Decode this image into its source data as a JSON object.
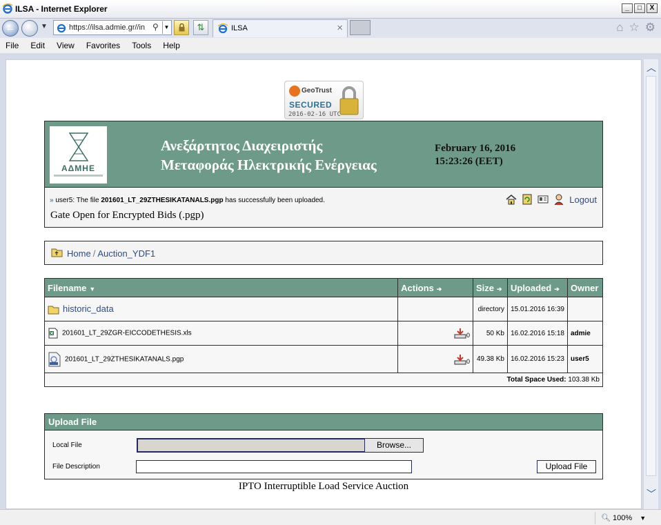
{
  "window": {
    "title": "ILSA - Internet Explorer",
    "controls": {
      "minimize": "_",
      "maximize": "□",
      "close": "X"
    }
  },
  "browser": {
    "address": "https://ilsa.admie.gr//in",
    "tab_title": "ILSA",
    "tab_close": "×",
    "menu": [
      "File",
      "Edit",
      "View",
      "Favorites",
      "Tools",
      "Help"
    ],
    "zoom": "100%"
  },
  "badge": {
    "brand": "GeoTrust",
    "secured": "SECURED",
    "date": "2016-02-16 UTC"
  },
  "header": {
    "logo_text": "ΑΔΜΗΕ",
    "title_line1": "Ανεξάρτητος Διαχειριστής",
    "title_line2": "Μεταφοράς Ηλεκτρικής Ενέργειας",
    "date": "February 16, 2016",
    "time": "15:23:26 (EET)"
  },
  "message": {
    "prefix": "»",
    "user": "user5: The file",
    "file": "201601_LT_29ZTHESIKATANALS.pgp",
    "suffix": "has successfully been uploaded.",
    "gate": "Gate Open for Encrypted Bids (.pgp)",
    "logout": "Logout"
  },
  "breadcrumb": {
    "home": "Home",
    "separator": "/",
    "current": "Auction_YDF1"
  },
  "table": {
    "headers": {
      "filename": "Filename",
      "actions": "Actions",
      "size": "Size",
      "uploaded": "Uploaded",
      "owner": "Owner"
    },
    "sort_arrows": {
      "filename": "▼",
      "actions": "➔",
      "size": "➔",
      "uploaded": "➔"
    },
    "rows": [
      {
        "name": "historic_data",
        "size": "directory",
        "uploaded": "15.01.2016 16:39",
        "owner": "",
        "downloads": ""
      },
      {
        "name": "201601_LT_29ZGR-EICCODETHESIS.xls",
        "size": "50 Kb",
        "uploaded": "16.02.2016 15:18",
        "owner": "admie",
        "downloads": "0"
      },
      {
        "name": "201601_LT_29ZTHESIKATANALS.pgp",
        "size": "49.38 Kb",
        "uploaded": "16.02.2016 15:23",
        "owner": "user5",
        "downloads": "0"
      }
    ],
    "total_label": "Total Space Used:",
    "total_value": "103.38 Kb"
  },
  "upload": {
    "title": "Upload File",
    "local_file_label": "Local File",
    "browse_label": "Browse...",
    "description_label": "File Description",
    "upload_button": "Upload File"
  },
  "footer": "IPTO Interruptible Load Service Auction",
  "colors": {
    "accent": "#6d9a89",
    "link": "#2a4c8a"
  }
}
